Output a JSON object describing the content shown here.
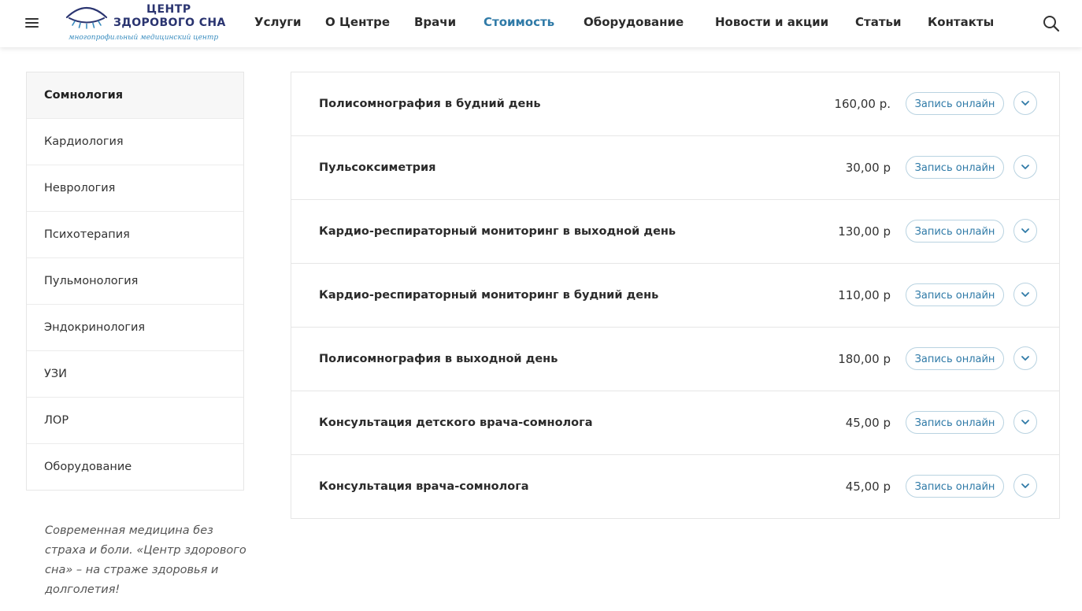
{
  "header": {
    "logo": {
      "line1": "ЦЕНТР",
      "line2": "ЗДОРОВОГО СНА",
      "tagline": "многопрофильный медицинский центр"
    },
    "nav": [
      {
        "label": "Услуги"
      },
      {
        "label": "О Центре"
      },
      {
        "label": "Врачи"
      },
      {
        "label": "Стоимость",
        "active": true
      },
      {
        "label": "Оборудование"
      },
      {
        "label": "Новости и акции"
      },
      {
        "label": "Статьи"
      },
      {
        "label": "Контакты"
      }
    ],
    "icons": {
      "menu": "hamburger-menu-icon",
      "search": "search-icon"
    }
  },
  "sidebar": {
    "items": [
      {
        "label": "Сомнология",
        "active": true
      },
      {
        "label": "Кардиология"
      },
      {
        "label": "Неврология"
      },
      {
        "label": "Психотерапия"
      },
      {
        "label": "Пульмонология"
      },
      {
        "label": "Эндокринология"
      },
      {
        "label": "УЗИ"
      },
      {
        "label": "ЛОР"
      },
      {
        "label": "Оборудование"
      }
    ],
    "motto": "Современная медицина без страха и боли. «Центр здорового сна» – на страже здоровья и долголетия!"
  },
  "prices": {
    "items": [
      {
        "title": "Полисомнография в будний день",
        "price": "160,00 р.",
        "button": "Запись онлайн"
      },
      {
        "title": "Пульсоксиметрия",
        "price": "30,00 р",
        "button": "Запись онлайн"
      },
      {
        "title": "Кардио-респираторный мониторинг в выходной день",
        "price": "130,00 р",
        "button": "Запись онлайн"
      },
      {
        "title": "Кардио-респираторный мониторинг в будний день",
        "price": "110,00 р",
        "button": "Запись онлайн"
      },
      {
        "title": "Полисомнография в выходной день",
        "price": "180,00 р",
        "button": "Запись онлайн"
      },
      {
        "title": "Консультация детского врача-сомнолога",
        "price": "45,00 р",
        "button": "Запись онлайн"
      },
      {
        "title": "Консультация врача-сомнолога",
        "price": "45,00 р",
        "button": "Запись онлайн"
      }
    ]
  },
  "colors": {
    "accent": "#2f7aa7",
    "logo_dark": "#2a3470",
    "logo_light": "#3a8dbf",
    "border": "#e6e6e6",
    "button_border": "#b9d3e1"
  }
}
